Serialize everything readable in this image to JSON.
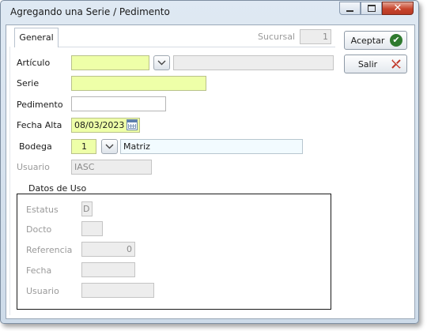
{
  "window": {
    "title": "Agregando una Serie / Pedimento"
  },
  "tabs": [
    {
      "label": "General"
    }
  ],
  "sucursal": {
    "label": "Sucursal",
    "value": "1"
  },
  "form": {
    "articulo": {
      "label": "Artículo",
      "value": "",
      "description": ""
    },
    "serie": {
      "label": "Serie",
      "value": ""
    },
    "pedimento": {
      "label": "Pedimento",
      "value": ""
    },
    "fecha_alta": {
      "label": "Fecha Alta",
      "value": "08/03/2023"
    },
    "bodega": {
      "label": "Bodega",
      "value": "1",
      "name": "Matriz"
    },
    "usuario": {
      "label": "Usuario",
      "value": "IASC"
    }
  },
  "datos_de_uso": {
    "title": "Datos de Uso",
    "estatus": {
      "label": "Estatus",
      "value": "D"
    },
    "docto": {
      "label": "Docto",
      "value": ""
    },
    "referencia": {
      "label": "Referencia",
      "value": "0"
    },
    "fecha": {
      "label": "Fecha",
      "value": ""
    },
    "usuario": {
      "label": "Usuario",
      "value": ""
    }
  },
  "buttons": {
    "aceptar": "Aceptar",
    "salir": "Salir"
  },
  "icons": {
    "ok": "checkmark-circle-icon",
    "cancel": "x-icon",
    "dropdown": "chevron-down-icon",
    "calendar": "calendar-icon"
  },
  "colors": {
    "required_field": "#eeffa8",
    "close_button": "#c7452d",
    "ok_icon": "#2f7a2f"
  }
}
